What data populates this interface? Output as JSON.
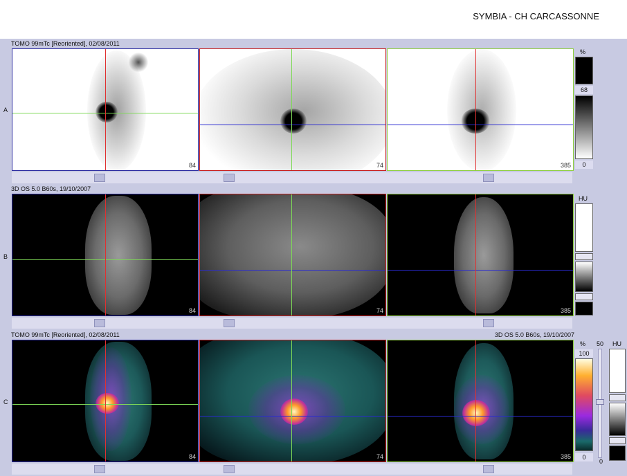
{
  "header": {
    "title": "SYMBIA - CH CARCASSONNE"
  },
  "rows": {
    "a": {
      "letter": "A",
      "caption": "TOMO 99mTc [Reoriented], 02/08/2011"
    },
    "b": {
      "letter": "B",
      "caption": "3D  OS  5.0  B60s, 19/10/2007"
    },
    "c": {
      "letter": "C",
      "caption_left": "TOMO 99mTc [Reoriented], 02/08/2011",
      "caption_right": "3D  OS  5.0  B60s, 19/10/2007"
    }
  },
  "slices": {
    "sagittal": "84",
    "axial": "74",
    "coronal": "385"
  },
  "colorbars": {
    "a": {
      "unit": "%",
      "window_top": "68",
      "window_bottom": "0"
    },
    "b": {
      "unit": "HU"
    },
    "c": {
      "unit_pet": "%",
      "pet_max": "100",
      "pet_min": "0",
      "fusion_top": "50",
      "fusion_bottom": "0",
      "unit_ct": "HU"
    }
  },
  "colors": {
    "crosshair_red": "#e03030",
    "crosshair_green": "#7ed957",
    "crosshair_blue": "#2a2ad0",
    "workspace_bg": "#c8cae2"
  }
}
